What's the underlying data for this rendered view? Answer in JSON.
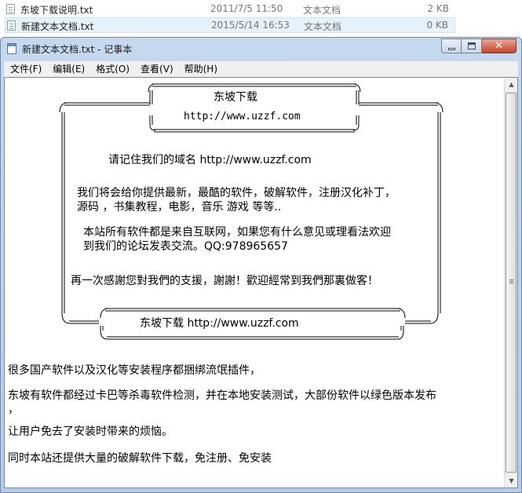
{
  "explorer": {
    "files": [
      {
        "name": "东坡下载说明.txt",
        "date": "2011/7/5 11:50",
        "type": "文本文档",
        "size": "2 KB"
      },
      {
        "name": "新建文本文档.txt",
        "date": "2015/5/14 16:53",
        "type": "文本文档",
        "size": "0 KB"
      }
    ]
  },
  "window": {
    "title": "新建文本文档.txt - 记事本",
    "close_glyph": "✕"
  },
  "menu": {
    "items": [
      "文件(F)",
      "编辑(E)",
      "格式(O)",
      "查看(V)",
      "帮助(H)"
    ]
  },
  "content": {
    "box": {
      "header_title": "东坡下载",
      "header_url": "http://www.uzzf.com",
      "remember": "请记住我们的域名 http://www.uzzf.com",
      "line1a": "我们将会给你提供最新，最酷的软件，破解软件，注册汉化补丁，",
      "line1b": "源码 ，书集教程，电影，音乐 游戏 等等..",
      "line2a": "本站所有软件都是来自互联网，如果您有什么意见或理看法欢迎",
      "line2b": "到我们的论坛发表交流。QQ:978965657",
      "thanks": "再一次感謝您對我們的支援，謝謝！歡迎經常到我們那裏做客！",
      "footer": "东坡下载 http://www.uzzf.com"
    },
    "paragraphs": [
      "很多国产软件以及汉化等安装程序都捆绑流氓插件，",
      "东坡有软件都经过卡巴等杀毒软件检测，并在本地安装测试，大部份软件以绿色版本发布",
      "，",
      "让用户免去了安装时带来的烦恼。",
      "同时本站还提供大量的破解软件下载，免注册、免安装"
    ]
  },
  "icons": {
    "file": "text-file-icon",
    "app": "notepad-icon",
    "minimize": "minimize-icon",
    "maximize": "maximize-icon",
    "close": "close-icon"
  },
  "colors": {
    "window_frame": "#b6cce8",
    "close_button": "#c7452b",
    "selected_row": "#e5f1fb"
  }
}
